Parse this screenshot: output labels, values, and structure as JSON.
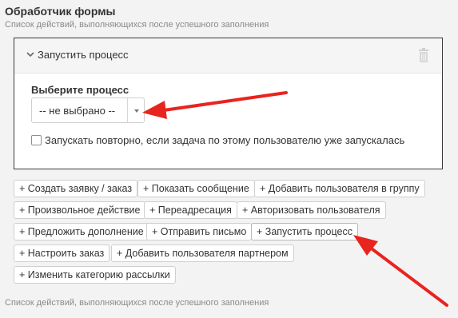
{
  "form_handler": {
    "title": "Обработчик формы",
    "subtitle": "Список действий, выполняющихся после успешного заполнения",
    "footer_note": "Список действий, выполняющихся после успешного заполнения"
  },
  "action_panel": {
    "title": "Запустить процесс",
    "field_label": "Выберите процесс",
    "select_value": "-- не выбрано --",
    "checkbox_label": "Запускать повторно, если задача по этому пользователю уже запускалась",
    "checkbox_checked": false
  },
  "add_buttons": [
    "+ Создать заявку / заказ",
    "+ Показать сообщение",
    "+ Добавить пользователя в группу",
    "+ Произвольное действие",
    "+ Переадресация",
    "+ Авторизовать пользователя",
    "+ Предложить дополнение",
    "+ Отправить письмо",
    "+ Запустить процесс",
    "+ Настроить заказ",
    "+ Добавить пользователя партнером",
    "+ Изменить категорию рассылки"
  ],
  "icons": {
    "collapse": "chevron-down-icon",
    "delete": "trash-icon",
    "dropdown": "caret-down-icon"
  },
  "colors": {
    "annotation_arrow": "#e8241f",
    "panel_border": "#3a3a3a",
    "muted_text": "#8a8a8a"
  }
}
